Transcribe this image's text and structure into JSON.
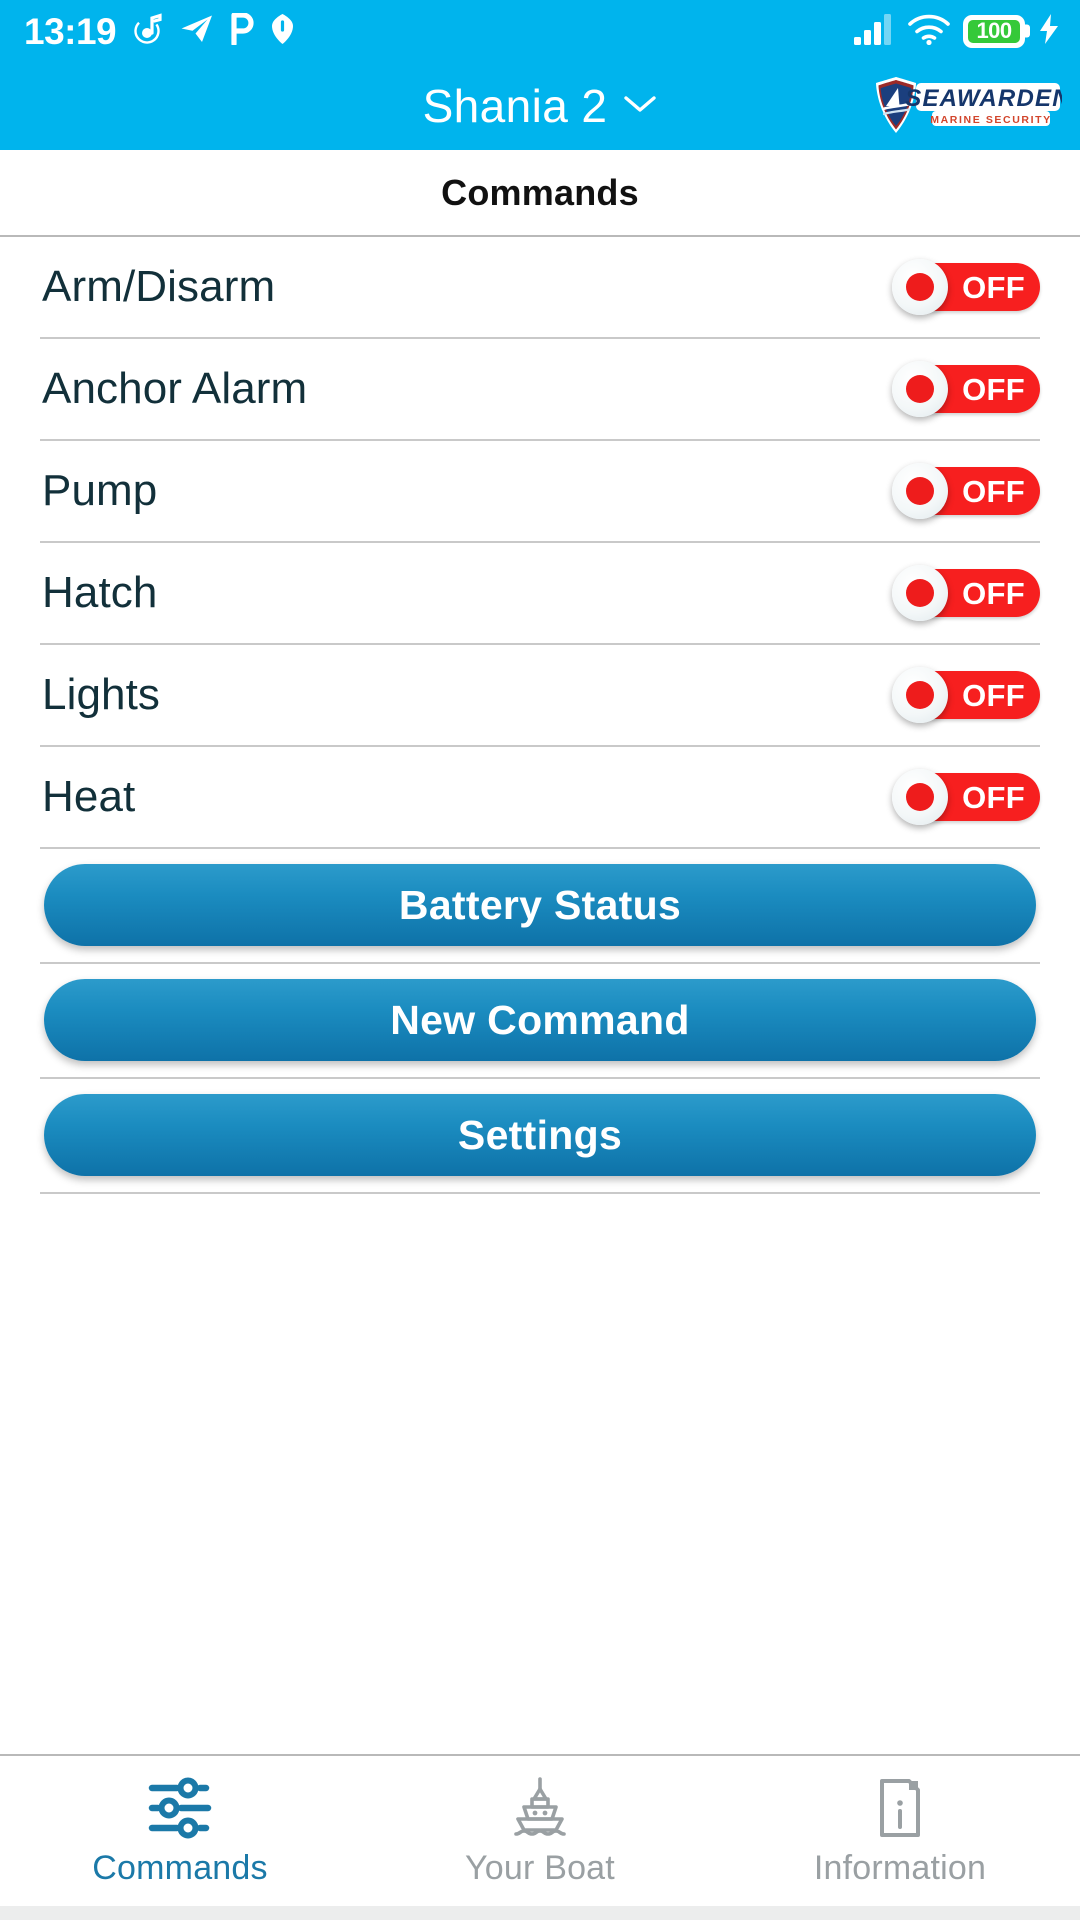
{
  "statusbar": {
    "time": "13:19",
    "notification_icons": [
      "music-note-icon",
      "telegram-plane-icon",
      "letter-p-icon",
      "shield-icon"
    ],
    "signal_icon": "cellular-signal-icon",
    "wifi_icon": "wifi-icon",
    "battery_percent": "100",
    "battery_color": "#35c939",
    "charging_icon": "lightning-bolt-icon",
    "background_color": "#00b4ed"
  },
  "appbar": {
    "vessel_name": "Shania 2",
    "dropdown_icon": "chevron-down-icon",
    "logo": {
      "brand": "SEAWARDEN",
      "tagline": "MARINE SECURITY",
      "shield_icon": "shield-boat-logo-icon",
      "brand_color": "#15366b",
      "tagline_color": "#d2452c"
    },
    "background_color": "#00b4ed"
  },
  "page": {
    "title": "Commands"
  },
  "commands": [
    {
      "label": "Arm/Disarm",
      "state": "OFF"
    },
    {
      "label": "Anchor Alarm",
      "state": "OFF"
    },
    {
      "label": "Pump",
      "state": "OFF"
    },
    {
      "label": "Hatch",
      "state": "OFF"
    },
    {
      "label": "Lights",
      "state": "OFF"
    },
    {
      "label": "Heat",
      "state": "OFF"
    }
  ],
  "toggle_colors": {
    "off_track": "#f71f1f",
    "knob": "#ffffff",
    "knob_dot": "#ee1c1c"
  },
  "buttons": [
    {
      "label": "Battery Status"
    },
    {
      "label": "New Command"
    },
    {
      "label": "Settings"
    }
  ],
  "button_colors": {
    "gradient_top": "#2c9bcb",
    "gradient_bottom": "#0e72a8",
    "text": "#ffffff"
  },
  "bottom_nav": {
    "active_color": "#1b79a8",
    "inactive_color": "#9aa0a3",
    "items": [
      {
        "label": "Commands",
        "icon": "sliders-icon",
        "active": true
      },
      {
        "label": "Your Boat",
        "icon": "ship-icon",
        "active": false
      },
      {
        "label": "Information",
        "icon": "info-card-icon",
        "active": false
      }
    ]
  }
}
